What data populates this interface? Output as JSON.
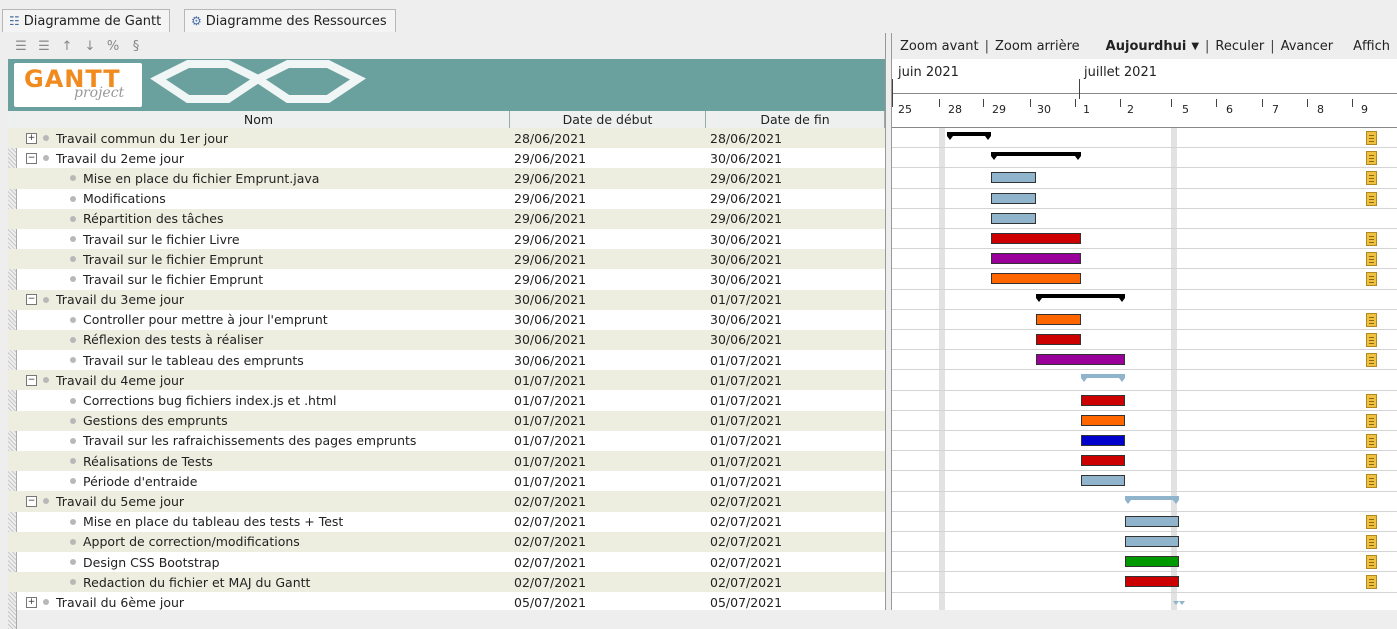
{
  "tabs": [
    {
      "label": "Diagramme de Gantt",
      "icon": "gantt-icon"
    },
    {
      "label": "Diagramme des Ressources",
      "icon": "resources-icon"
    }
  ],
  "logo": {
    "text1": "GANTT",
    "text2": "project"
  },
  "table": {
    "headers": [
      "Nom",
      "Date de début",
      "Date de fin"
    ],
    "rows": [
      {
        "name": "Travail commun du 1er jour",
        "start": "28/06/2021",
        "end": "28/06/2021",
        "level": 0,
        "toggle": "+",
        "selected": true
      },
      {
        "name": "Travail du 2eme jour",
        "start": "29/06/2021",
        "end": "30/06/2021",
        "level": 0,
        "toggle": "−"
      },
      {
        "name": "Mise en place du fichier Emprunt.java",
        "start": "29/06/2021",
        "end": "29/06/2021",
        "level": 1
      },
      {
        "name": "Modifications",
        "start": "29/06/2021",
        "end": "29/06/2021",
        "level": 1
      },
      {
        "name": "Répartition des tâches",
        "start": "29/06/2021",
        "end": "29/06/2021",
        "level": 1
      },
      {
        "name": "Travail sur le fichier Livre",
        "start": "29/06/2021",
        "end": "30/06/2021",
        "level": 1
      },
      {
        "name": "Travail sur le fichier Emprunt",
        "start": "29/06/2021",
        "end": "30/06/2021",
        "level": 1
      },
      {
        "name": "Travail sur le fichier Emprunt",
        "start": "29/06/2021",
        "end": "30/06/2021",
        "level": 1
      },
      {
        "name": "Travail du 3eme jour",
        "start": "30/06/2021",
        "end": "01/07/2021",
        "level": 0,
        "toggle": "−"
      },
      {
        "name": "Controller pour mettre à jour l'emprunt",
        "start": "30/06/2021",
        "end": "30/06/2021",
        "level": 1
      },
      {
        "name": "Réflexion des tests à réaliser",
        "start": "30/06/2021",
        "end": "30/06/2021",
        "level": 1
      },
      {
        "name": "Travail sur le tableau des emprunts",
        "start": "30/06/2021",
        "end": "01/07/2021",
        "level": 1
      },
      {
        "name": "Travail du 4eme jour",
        "start": "01/07/2021",
        "end": "01/07/2021",
        "level": 0,
        "toggle": "−"
      },
      {
        "name": "Corrections bug fichiers index.js et .html",
        "start": "01/07/2021",
        "end": "01/07/2021",
        "level": 1
      },
      {
        "name": "Gestions des emprunts",
        "start": "01/07/2021",
        "end": "01/07/2021",
        "level": 1
      },
      {
        "name": "Travail sur les rafraichissements des pages emprunts",
        "start": "01/07/2021",
        "end": "01/07/2021",
        "level": 1
      },
      {
        "name": "Réalisations de Tests",
        "start": "01/07/2021",
        "end": "01/07/2021",
        "level": 1
      },
      {
        "name": "Période d'entraide",
        "start": "01/07/2021",
        "end": "01/07/2021",
        "level": 1
      },
      {
        "name": "Travail du 5eme jour",
        "start": "02/07/2021",
        "end": "02/07/2021",
        "level": 0,
        "toggle": "−"
      },
      {
        "name": "Mise en place du tableau des tests + Test",
        "start": "02/07/2021",
        "end": "02/07/2021",
        "level": 1
      },
      {
        "name": "Apport de correction/modifications",
        "start": "02/07/2021",
        "end": "02/07/2021",
        "level": 1
      },
      {
        "name": "Design CSS Bootstrap",
        "start": "02/07/2021",
        "end": "02/07/2021",
        "level": 1
      },
      {
        "name": "Redaction du fichier et MAJ du Gantt",
        "start": "02/07/2021",
        "end": "02/07/2021",
        "level": 1
      },
      {
        "name": "Travail du 6ème jour",
        "start": "05/07/2021",
        "end": "05/07/2021",
        "level": 0,
        "toggle": "+"
      }
    ]
  },
  "chart_toolbar": {
    "zoom_in": "Zoom avant",
    "zoom_out": "Zoom arrière",
    "today": "Aujourdhui",
    "back": "Reculer",
    "forward": "Avancer",
    "show": "Affich"
  },
  "timeline": {
    "months": [
      "juin 2021",
      "juillet 2021"
    ],
    "days": [
      "25",
      "28",
      "29",
      "30",
      "1",
      "2",
      "5",
      "6",
      "7",
      "8",
      "9"
    ]
  },
  "bars": [
    {
      "row": 0,
      "type": "summary",
      "color": "#000000",
      "start": 1,
      "len": 1
    },
    {
      "row": 1,
      "type": "summary",
      "color": "#000000",
      "start": 2,
      "len": 2
    },
    {
      "row": 2,
      "type": "task",
      "color": "#8fb4cc",
      "start": 2,
      "len": 1
    },
    {
      "row": 3,
      "type": "task",
      "color": "#8fb4cc",
      "start": 2,
      "len": 1
    },
    {
      "row": 4,
      "type": "task",
      "color": "#8fb4cc",
      "start": 2,
      "len": 1
    },
    {
      "row": 5,
      "type": "task",
      "color": "#cc0000",
      "start": 2,
      "len": 2
    },
    {
      "row": 6,
      "type": "task",
      "color": "#990099",
      "start": 2,
      "len": 2
    },
    {
      "row": 7,
      "type": "task",
      "color": "#ff6600",
      "start": 2,
      "len": 2
    },
    {
      "row": 8,
      "type": "summary",
      "color": "#000000",
      "start": 3,
      "len": 2
    },
    {
      "row": 9,
      "type": "task",
      "color": "#ff6600",
      "start": 3,
      "len": 1
    },
    {
      "row": 10,
      "type": "task",
      "color": "#cc0000",
      "start": 3,
      "len": 1
    },
    {
      "row": 11,
      "type": "task",
      "color": "#990099",
      "start": 3,
      "len": 2
    },
    {
      "row": 12,
      "type": "summary",
      "color": "#8fb4cc",
      "start": 4,
      "len": 1
    },
    {
      "row": 13,
      "type": "task",
      "color": "#cc0000",
      "start": 4,
      "len": 1
    },
    {
      "row": 14,
      "type": "task",
      "color": "#ff6600",
      "start": 4,
      "len": 1
    },
    {
      "row": 15,
      "type": "task",
      "color": "#0000cc",
      "start": 4,
      "len": 1
    },
    {
      "row": 16,
      "type": "task",
      "color": "#cc0000",
      "start": 4,
      "len": 1
    },
    {
      "row": 17,
      "type": "task",
      "color": "#8fb4cc",
      "start": 4,
      "len": 1
    },
    {
      "row": 18,
      "type": "summary",
      "color": "#8fb4cc",
      "start": 5,
      "len": 1
    },
    {
      "row": 19,
      "type": "task",
      "color": "#8fb4cc",
      "start": 5,
      "len": 1
    },
    {
      "row": 20,
      "type": "task",
      "color": "#8fb4cc",
      "start": 5,
      "len": 1
    },
    {
      "row": 21,
      "type": "task",
      "color": "#009900",
      "start": 5,
      "len": 1
    },
    {
      "row": 22,
      "type": "task",
      "color": "#cc0000",
      "start": 5,
      "len": 1
    },
    {
      "row": 23,
      "type": "summary",
      "color": "#8fb4cc",
      "start": 6,
      "len": 1
    }
  ],
  "notes_rows": [
    0,
    1,
    2,
    3,
    5,
    6,
    7,
    9,
    10,
    11,
    13,
    14,
    15,
    16,
    17,
    19,
    20,
    21,
    22
  ]
}
